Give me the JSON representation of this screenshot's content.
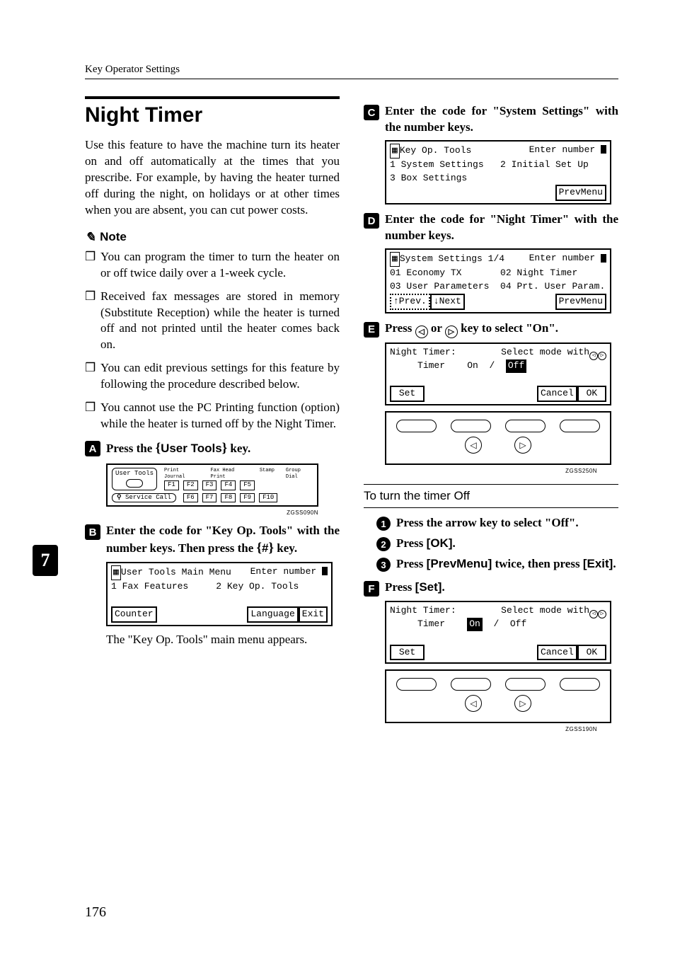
{
  "header": "Key Operator Settings",
  "side_tab": "7",
  "page_number": "176",
  "section_title": "Night Timer",
  "intro": "Use this feature to have the machine turn its heater on and off automatically at the times that you prescribe. For example, by having the heater turned off during the night, on holidays or at other times when you are absent, you can cut power costs.",
  "note_label": "Note",
  "notes": [
    "You can program the timer to turn the heater on or off twice daily over a 1-week cycle.",
    "Received fax messages are stored in memory (Substitute Reception) while the heater is turned off and not printed until the heater comes back on.",
    "You can edit previous settings for this feature by following the procedure described below.",
    "You cannot use the PC Printing function (option) while the heater is turned off by the Night Timer."
  ],
  "steps": {
    "s1": {
      "pre": "Press the ",
      "key": "User Tools",
      "post": " key."
    },
    "s2": {
      "pre": "Enter the code for \"Key Op. Tools\" with the number keys. Then press the ",
      "hash": "#",
      "post": " key."
    },
    "s3": "Enter the code for \"System Settings\" with the number keys.",
    "s4": "Enter the code for \"Night Timer\" with the number keys.",
    "s5": {
      "pre": "Press ",
      "mid": " or ",
      "post": " key to select \"On\"."
    },
    "s6": {
      "pre": "Press ",
      "key": "[Set]",
      "post": "."
    }
  },
  "panel1": {
    "user_tools": "User Tools",
    "print_journal": "Print Journal",
    "fax_head": "Fax Head Print",
    "stamp": "Stamp",
    "group": "Group Dial",
    "f_row1": [
      "F1",
      "F2",
      "F3",
      "F4",
      "F5"
    ],
    "service": "Service Call",
    "f_row2": [
      "F6",
      "F7",
      "F8",
      "F9",
      "F10"
    ],
    "code": "ZGSS090N"
  },
  "lcd_b": {
    "l1_left": "User Tools Main Menu",
    "l1_right_pre": "Enter number ",
    "l2_left": "1 Fax Features",
    "l2_right": "2 Key Op. Tools",
    "l4_left": "Counter",
    "l4_mid": "Language",
    "l4_right": "Exit"
  },
  "result_b": "The \"Key Op. Tools\" main menu appears.",
  "lcd_c": {
    "l1_left": "Key Op. Tools",
    "l1_right_pre": "Enter number ",
    "l2_left": "1 System Settings",
    "l2_right": "2 Initial Set Up",
    "l3_left": "3 Box Settings",
    "l4_right": "PrevMenu"
  },
  "lcd_d": {
    "l1_left": "System Settings 1/4",
    "l1_right_pre": "Enter number ",
    "l2_left": "01 Economy TX",
    "l2_right": "02 Night Timer",
    "l3_left": "03 User Parameters",
    "l3_right": "04 Prt. User Param.",
    "l4_prev": "↑Prev.",
    "l4_next": "↓Next",
    "l4_right": "PrevMenu"
  },
  "lcd_e": {
    "l1_left": "Night Timer:",
    "l1_right": "Select mode with",
    "l2_label": "Timer",
    "l2_on": "On",
    "l2_off": "Off",
    "l4_set": "Set",
    "l4_cancel": "Cancel",
    "l4_ok": "OK",
    "code": "ZGSS250N"
  },
  "sub_heading": "To turn the timer Off",
  "substeps": {
    "a": "Press the arrow key to select \"Off\".",
    "b_pre": "Press ",
    "b_key": "[OK]",
    "b_post": ".",
    "c_pre": "Press ",
    "c_key1": "[PrevMenu]",
    "c_mid": " twice, then press ",
    "c_key2": "[Exit]",
    "c_post": "."
  },
  "lcd_f": {
    "l1_left": "Night Timer:",
    "l1_right": "Select mode with",
    "l2_label": "Timer",
    "l2_on": "On",
    "l2_off": "Off",
    "l4_set": "Set",
    "l4_cancel": "Cancel",
    "l4_ok": "OK",
    "code": "ZGSS190N"
  }
}
